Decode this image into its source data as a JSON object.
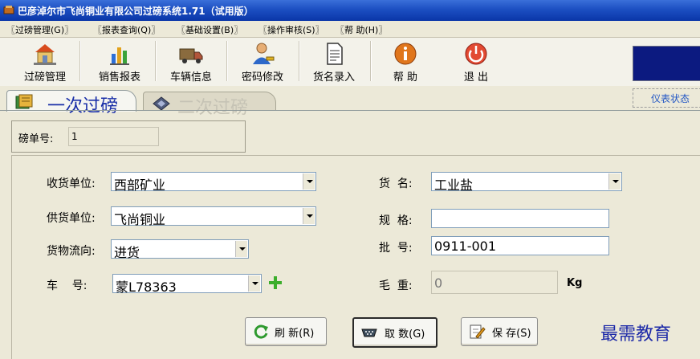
{
  "window": {
    "title": "巴彦淖尔市飞尚铜业有限公司过磅系统1.71（试用版）"
  },
  "menu": [
    "〖过磅管理(G)〗",
    "〖报表查询(Q)〗",
    "〖基础设置(B)〗",
    "〖操作审核(S)〗",
    "〖帮 助(H)〗"
  ],
  "toolbar": [
    {
      "label": "过磅管理",
      "icon": "scale-house-icon"
    },
    {
      "label": "销售报表",
      "icon": "bar-chart-icon"
    },
    {
      "label": "车辆信息",
      "icon": "truck-icon"
    },
    {
      "label": "密码修改",
      "icon": "user-key-icon"
    },
    {
      "label": "货名录入",
      "icon": "document-icon"
    },
    {
      "label": "帮 助",
      "icon": "info-icon"
    },
    {
      "label": "退 出",
      "icon": "power-icon"
    }
  ],
  "tabs": [
    {
      "label": "一次过磅",
      "active": true
    },
    {
      "label": "二次过磅",
      "active": false
    }
  ],
  "gauge_status": "仪表状态",
  "form": {
    "ticket_label": "磅单号:",
    "ticket_value": "1",
    "receiver_label": "收货单位:",
    "receiver_value": "西部矿业",
    "supplier_label": "供货单位:",
    "supplier_value": "飞尚铜业",
    "flow_label": "货物流向:",
    "flow_value": "进货",
    "vehicle_label": "车    号:",
    "vehicle_value": "蒙L78363",
    "goods_label": "货  名:",
    "goods_value": "工业盐",
    "spec_label": "规  格:",
    "spec_value": "",
    "batch_label": "批  号:",
    "batch_value": "0911-001",
    "gross_label": "毛  重:",
    "gross_value": "0",
    "gross_unit": "Kg"
  },
  "actions": {
    "refresh": "刷 新(R)",
    "fetch": "取 数(G)",
    "save": "保 存(S)"
  },
  "watermark": "最需教育",
  "colors": {
    "title_bar": "#1c4fc2",
    "active_tab_text": "#1a2fa8",
    "lcd": "#0c1a80",
    "accent_green": "#3cae2c"
  }
}
